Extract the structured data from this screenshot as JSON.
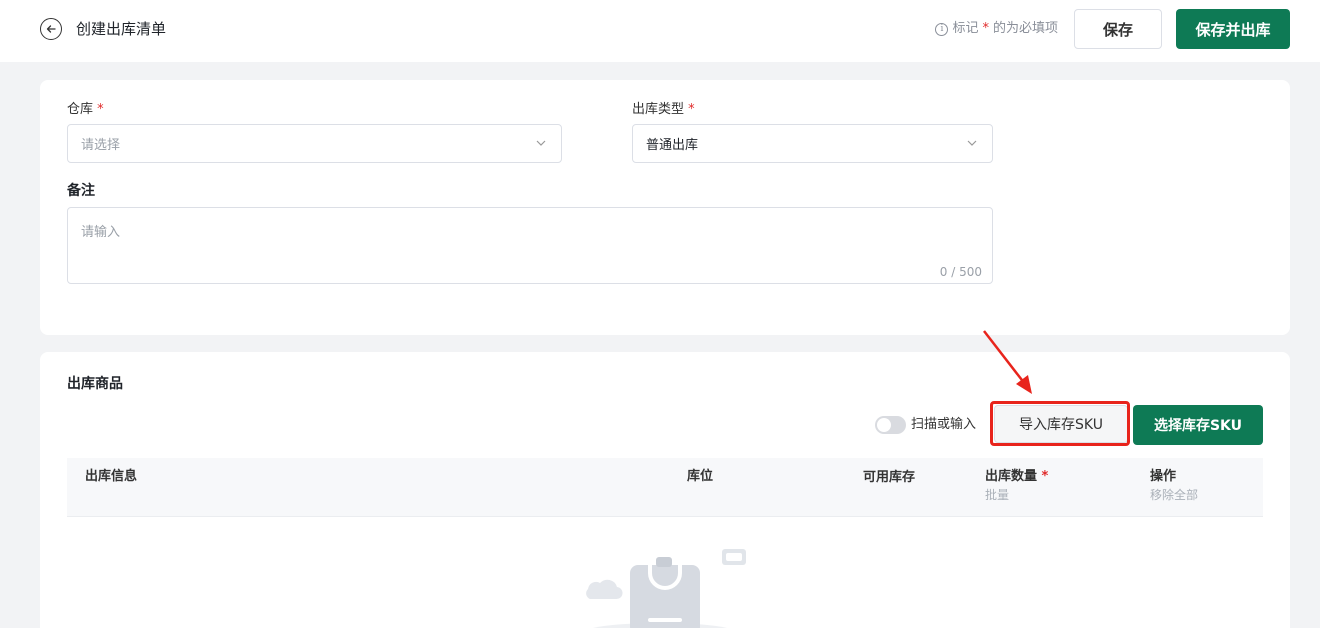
{
  "header": {
    "title": "创建出库清单",
    "required_note_prefix": "标记",
    "required_star": "*",
    "required_note_suffix": "的为必填项",
    "save_label": "保存",
    "save_and_out_label": "保存并出库"
  },
  "form": {
    "warehouse_label": "仓库",
    "warehouse_placeholder": "请选择",
    "out_type_label": "出库类型",
    "out_type_value": "普通出库",
    "note_label": "备注",
    "note_placeholder": "请输入",
    "note_counter": "0 / 500",
    "star": "*"
  },
  "products": {
    "title": "出库商品",
    "scan_toggle_label": "扫描或输入",
    "import_label": "导入库存SKU",
    "select_label": "选择库存SKU",
    "columns": {
      "info": "出库信息",
      "location": "库位",
      "available": "可用库存",
      "quantity": "出库数量",
      "quantity_star": "*",
      "quantity_sub": "批量",
      "action": "操作",
      "action_sub": "移除全部"
    }
  },
  "colors": {
    "brand": "#0e7a55",
    "highlight": "#e8241c",
    "required": "#e02a2a"
  }
}
